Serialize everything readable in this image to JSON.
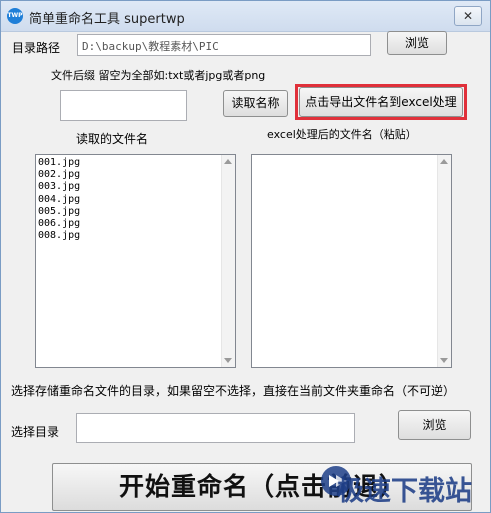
{
  "window": {
    "icon_text": "TWP",
    "title": "简单重命名工具 supertwp",
    "close_symbol": "✕"
  },
  "dir_row": {
    "label": "目录路径",
    "value": "D:\\backup\\教程素材\\PIC",
    "browse_label": "浏览"
  },
  "suffix": {
    "hint": "文件后缀 留空为全部如:txt或者jpg或者png",
    "value": ""
  },
  "buttons": {
    "read_names": "读取名称",
    "export_excel": "点击导出文件名到excel处理"
  },
  "lists": {
    "left_title": "读取的文件名",
    "right_title": "excel处理后的文件名（粘贴）",
    "left_items": [
      "001.jpg",
      "002.jpg",
      "003.jpg",
      "004.jpg",
      "005.jpg",
      "006.jpg",
      "008.jpg"
    ]
  },
  "save_hint": "选择存储重命名文件的目录，如果留空不选择，直接在当前文件夹重命名（不可逆）",
  "select_dir": {
    "label": "选择目录",
    "value": "",
    "browse_label": "浏览"
  },
  "start_button": "开始重命名（点击前退）",
  "watermark": "极速下载站",
  "colors": {
    "highlight": "#e0303a",
    "watermark": "#1f3f88",
    "title_bar": "#dfe9f6"
  }
}
